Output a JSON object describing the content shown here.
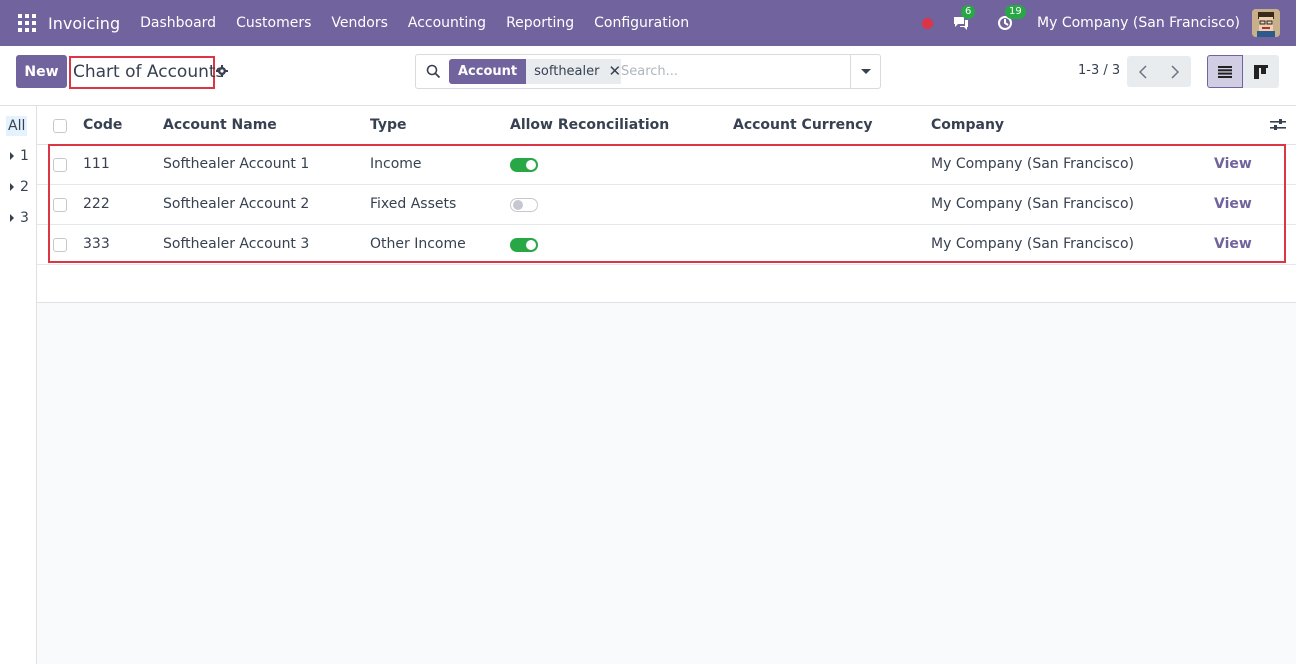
{
  "navbar": {
    "app_name": "Invoicing",
    "menu": [
      "Dashboard",
      "Customers",
      "Vendors",
      "Accounting",
      "Reporting",
      "Configuration"
    ],
    "messages_badge": "6",
    "activities_badge": "19",
    "company": "My Company (San Francisco)"
  },
  "control": {
    "new_label": "New",
    "title": "Chart of Accounts",
    "facet_category": "Account",
    "facet_value": "softhealer",
    "search_placeholder": "Search...",
    "pager": "1-3 / 3"
  },
  "sidebar": {
    "all_label": "All",
    "groups": [
      "1",
      "2",
      "3"
    ]
  },
  "table": {
    "columns": [
      "Code",
      "Account Name",
      "Type",
      "Allow Reconciliation",
      "Account Currency",
      "Company"
    ],
    "rows": [
      {
        "code": "111",
        "name": "Softhealer Account 1",
        "type": "Income",
        "reconcile": true,
        "currency": "",
        "company": "My Company (San Francisco)",
        "action": "View"
      },
      {
        "code": "222",
        "name": "Softhealer Account 2",
        "type": "Fixed Assets",
        "reconcile": false,
        "currency": "",
        "company": "My Company (San Francisco)",
        "action": "View"
      },
      {
        "code": "333",
        "name": "Softhealer Account 3",
        "type": "Other Income",
        "reconcile": true,
        "currency": "",
        "company": "My Company (San Francisco)",
        "action": "View"
      }
    ]
  },
  "colors": {
    "brand": "#71639e",
    "highlight": "#dc3545",
    "toggle_on": "#28a745"
  },
  "icons": [
    "apps-grid-icon",
    "record-dot-icon",
    "chat-icon",
    "clock-icon",
    "avatar",
    "gear-icon",
    "search-icon",
    "close-icon",
    "caret-down-icon",
    "chevron-left-icon",
    "chevron-right-icon",
    "list-view-icon",
    "kanban-view-icon",
    "sliders-icon"
  ]
}
